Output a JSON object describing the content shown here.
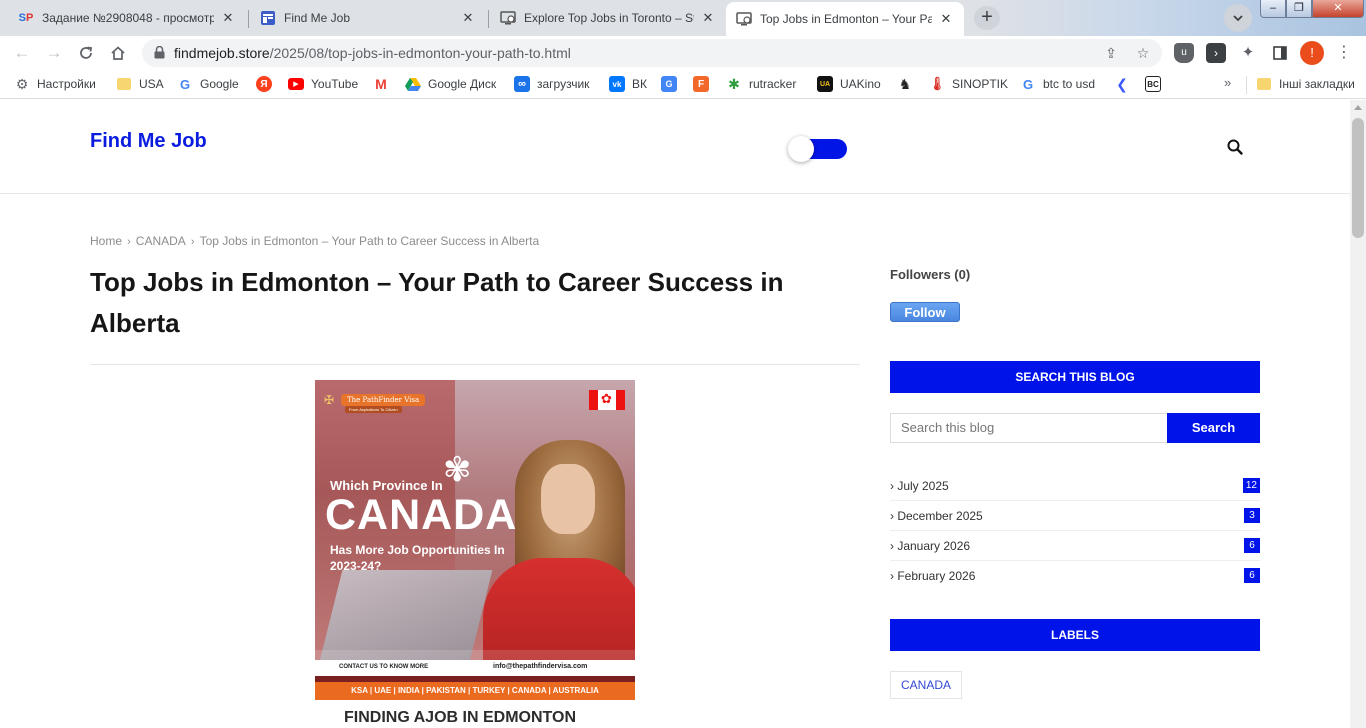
{
  "tabs": [
    {
      "favicon": "SP",
      "title": "Задание №2908048 - просмотр"
    },
    {
      "favicon": "find-me-job-favicon",
      "title": "Find Me Job"
    },
    {
      "favicon": "page-favicon",
      "title": "Explore Top Jobs in Toronto – Sta"
    },
    {
      "favicon": "page-favicon",
      "title": "Top Jobs in Edmonton – Your Pat"
    }
  ],
  "address": {
    "domain": "findmejob.store",
    "path": "/2025/08/top-jobs-in-edmonton-your-path-to.html"
  },
  "profile_initial": "!",
  "bookmarks": [
    {
      "icon": "gear-icon",
      "label": "Настройки"
    },
    {
      "icon": "folder-icon",
      "label": "USA"
    },
    {
      "icon": "google-icon",
      "label": "Google"
    },
    {
      "icon": "yandex-icon",
      "label": ""
    },
    {
      "icon": "youtube-icon",
      "label": "YouTube"
    },
    {
      "icon": "gmail-icon",
      "label": ""
    },
    {
      "icon": "google-drive-icon",
      "label": "Google Диск"
    },
    {
      "icon": "loop-icon",
      "label": "загрузчик"
    },
    {
      "icon": "vk-icon",
      "label": "ВК"
    },
    {
      "icon": "translate-icon",
      "label": ""
    },
    {
      "icon": "f-icon",
      "label": ""
    },
    {
      "icon": "rutracker-icon",
      "label": "rutracker"
    },
    {
      "icon": "uakino-icon",
      "label": "UAKino"
    },
    {
      "icon": "horse-icon",
      "label": ""
    },
    {
      "icon": "thermometer-icon",
      "label": "SINOPTIK"
    },
    {
      "icon": "google-icon",
      "label": "btc to usd"
    },
    {
      "icon": "arrow-left-icon",
      "label": ""
    },
    {
      "icon": "bc-icon",
      "label": ""
    }
  ],
  "bookmarks_other": "Інші закладки",
  "site": {
    "logo": "Find Me Job"
  },
  "breadcrumb": {
    "home": "Home",
    "category": "CANADA",
    "current": "Top Jobs in Edmonton – Your Path to Career Success in Alberta"
  },
  "post": {
    "title": "Top Jobs in Edmonton – Your Path to Career Success in Alberta",
    "subheading": "FINDING AJOB IN EDMONTON"
  },
  "poster": {
    "brand": "The PathFinder Visa",
    "tagline": "From Aspirations To Citizen",
    "line1": "Which Province In",
    "line2": "CANADA",
    "line3": "Has More Job Opportunities In 2023-24?",
    "contact": "CONTACT US TO KNOW MORE",
    "email": "info@thepathfindervisa.com",
    "countries": "KSA | UAE | INDIA | PAKISTAN | TURKEY | CANADA | AUSTRALIA"
  },
  "sidebar": {
    "followers": "Followers (0)",
    "follow_label": "Follow",
    "search_heading": "SEARCH THIS BLOG",
    "search_placeholder": "Search this blog",
    "search_button": "Search",
    "archive": [
      {
        "label": "› July 2025",
        "count": "12"
      },
      {
        "label": "› December 2025",
        "count": "3"
      },
      {
        "label": "› January 2026",
        "count": "6"
      },
      {
        "label": "› February 2026",
        "count": "6"
      }
    ],
    "labels_heading": "LABELS",
    "labels": [
      "CANADA"
    ]
  },
  "colors": {
    "accent": "#0013e8",
    "logo": "#0a1ce0"
  }
}
